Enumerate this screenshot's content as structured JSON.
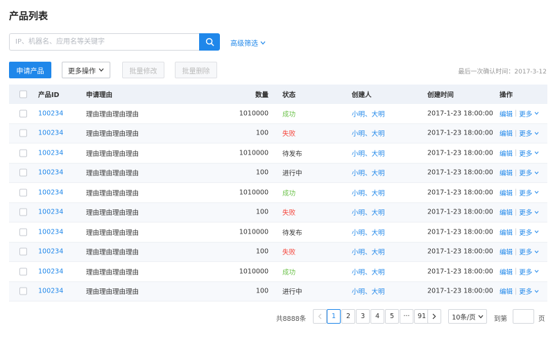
{
  "page_title": "产品列表",
  "search": {
    "placeholder": "IP、机器名、应用名等关键字",
    "value": ""
  },
  "advanced_filter": "高级筛选",
  "toolbar": {
    "apply_label": "申请产品",
    "more_label": "更多操作",
    "batch_edit_label": "批量修改",
    "batch_delete_label": "批量删除"
  },
  "last_confirm": "最后一次确认时间：2017-3-12",
  "table": {
    "headers": {
      "id": "产品ID",
      "reason": "申请理由",
      "qty": "数量",
      "status": "状态",
      "creator": "创建人",
      "time": "创建时间",
      "ops": "操作"
    },
    "ops": {
      "edit": "编辑",
      "more": "更多"
    },
    "rows": [
      {
        "id": "100234",
        "reason": "理由理由理由理由",
        "qty": "1010000",
        "status": "成功",
        "status_type": "ok",
        "creator": "小明、大明",
        "time": "2017-1-23 18:00:00"
      },
      {
        "id": "100234",
        "reason": "理由理由理由理由",
        "qty": "100",
        "status": "失败",
        "status_type": "fail",
        "creator": "小明、大明",
        "time": "2017-1-23 18:00:00"
      },
      {
        "id": "100234",
        "reason": "理由理由理由理由",
        "qty": "1010000",
        "status": "待发布",
        "status_type": "normal",
        "creator": "小明、大明",
        "time": "2017-1-23 18:00:00"
      },
      {
        "id": "100234",
        "reason": "理由理由理由理由",
        "qty": "100",
        "status": "进行中",
        "status_type": "normal",
        "creator": "小明、大明",
        "time": "2017-1-23 18:00:00"
      },
      {
        "id": "100234",
        "reason": "理由理由理由理由",
        "qty": "1010000",
        "status": "成功",
        "status_type": "ok",
        "creator": "小明、大明",
        "time": "2017-1-23 18:00:00"
      },
      {
        "id": "100234",
        "reason": "理由理由理由理由",
        "qty": "100",
        "status": "失败",
        "status_type": "fail",
        "creator": "小明、大明",
        "time": "2017-1-23 18:00:00"
      },
      {
        "id": "100234",
        "reason": "理由理由理由理由",
        "qty": "1010000",
        "status": "待发布",
        "status_type": "normal",
        "creator": "小明、大明",
        "time": "2017-1-23 18:00:00"
      },
      {
        "id": "100234",
        "reason": "理由理由理由理由",
        "qty": "100",
        "status": "失败",
        "status_type": "fail",
        "creator": "小明、大明",
        "time": "2017-1-23 18:00:00"
      },
      {
        "id": "100234",
        "reason": "理由理由理由理由",
        "qty": "1010000",
        "status": "成功",
        "status_type": "ok",
        "creator": "小明、大明",
        "time": "2017-1-23 18:00:00"
      },
      {
        "id": "100234",
        "reason": "理由理由理由理由",
        "qty": "100",
        "status": "进行中",
        "status_type": "normal",
        "creator": "小明、大明",
        "time": "2017-1-23 18:00:00"
      }
    ]
  },
  "pagination": {
    "total": "共8888条",
    "pages": [
      "1",
      "2",
      "3",
      "4",
      "5",
      "···",
      "91"
    ],
    "current": "1",
    "page_size": "10条/页",
    "goto_label": "到第",
    "goto_value": "",
    "page_unit": "页"
  },
  "colors": {
    "accent": "#1f87ea",
    "success": "#6cc24a",
    "danger": "#f5463c"
  }
}
